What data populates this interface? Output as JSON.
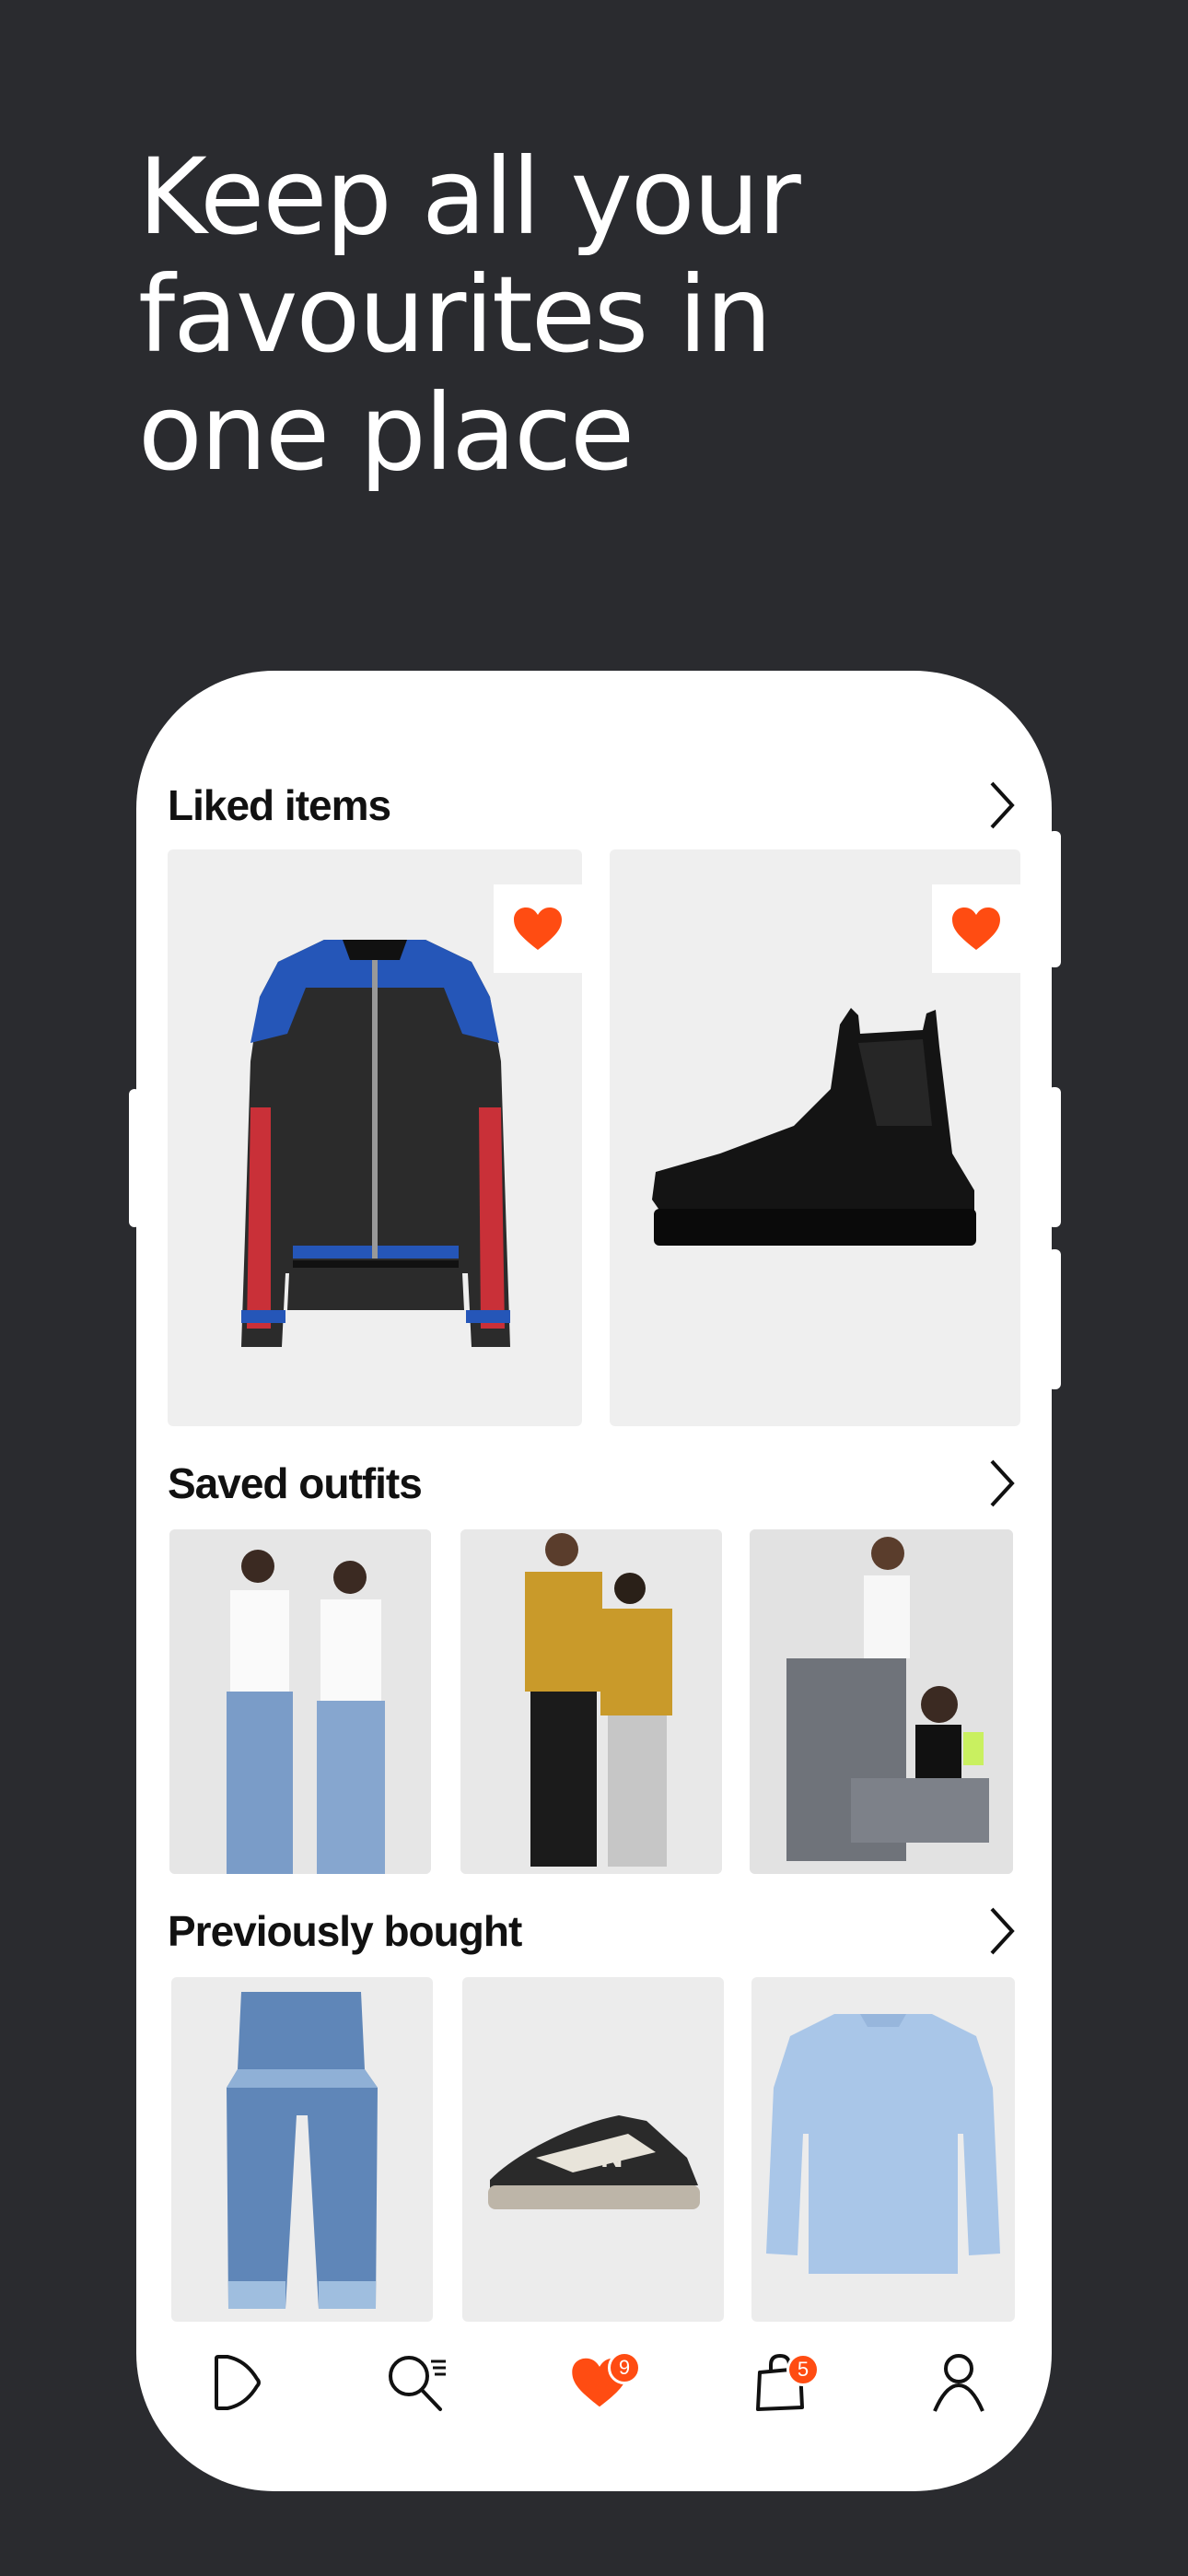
{
  "headline": {
    "line1": "Keep all your",
    "line2": "favourites in",
    "line3": "one place"
  },
  "colors": {
    "background": "#2a2b2f",
    "accent": "#ff4c12",
    "card": "#efefef",
    "text": "#111111"
  },
  "sections": {
    "liked": {
      "title": "Liked items",
      "items": [
        {
          "icon": "heart-icon",
          "image": "leather-bomber-jacket"
        },
        {
          "icon": "heart-icon",
          "image": "black-chelsea-boot"
        }
      ]
    },
    "outfits": {
      "title": "Saved outfits",
      "items": [
        {
          "image": "two-models-white-tees-wide-jeans"
        },
        {
          "image": "two-models-mustard-jackets"
        },
        {
          "image": "two-models-grey-trousers"
        }
      ]
    },
    "bought": {
      "title": "Previously bought",
      "items": [
        {
          "image": "frayed-wide-jeans"
        },
        {
          "image": "new-balance-sneaker"
        },
        {
          "image": "light-blue-sweatshirt"
        }
      ]
    }
  },
  "tabbar": {
    "items": [
      {
        "name": "home",
        "icon": "play-icon"
      },
      {
        "name": "search",
        "icon": "search-icon"
      },
      {
        "name": "favourites",
        "icon": "heart-icon",
        "badge": "9"
      },
      {
        "name": "bag",
        "icon": "bag-icon",
        "badge": "5"
      },
      {
        "name": "profile",
        "icon": "user-icon"
      }
    ]
  }
}
